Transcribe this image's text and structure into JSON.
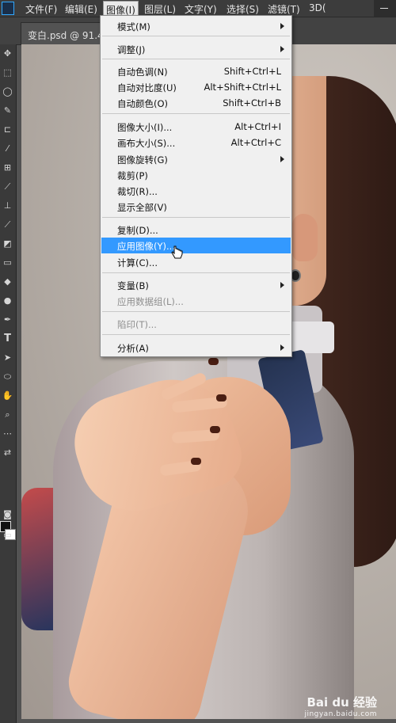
{
  "menubar": {
    "items": [
      "文件(F)",
      "编辑(E)",
      "图像(I)",
      "图层(L)",
      "文字(Y)",
      "选择(S)",
      "滤镜(T)",
      "3D("
    ]
  },
  "document_tab": {
    "title": "变白.psd @ 91.4%"
  },
  "image_menu": {
    "items": [
      {
        "label": "模式(M)",
        "submenu": true
      },
      {
        "label": "调整(J)",
        "submenu": true
      },
      {
        "label": "自动色调(N)",
        "shortcut": "Shift+Ctrl+L"
      },
      {
        "label": "自动对比度(U)",
        "shortcut": "Alt+Shift+Ctrl+L"
      },
      {
        "label": "自动颜色(O)",
        "shortcut": "Shift+Ctrl+B"
      },
      {
        "label": "图像大小(I)...",
        "shortcut": "Alt+Ctrl+I"
      },
      {
        "label": "画布大小(S)...",
        "shortcut": "Alt+Ctrl+C"
      },
      {
        "label": "图像旋转(G)",
        "submenu": true
      },
      {
        "label": "裁剪(P)"
      },
      {
        "label": "裁切(R)..."
      },
      {
        "label": "显示全部(V)"
      },
      {
        "label": "复制(D)..."
      },
      {
        "label": "应用图像(Y)...",
        "highlighted": true
      },
      {
        "label": "计算(C)..."
      },
      {
        "label": "变量(B)",
        "submenu": true
      },
      {
        "label": "应用数据组(L)...",
        "disabled": true
      },
      {
        "label": "陷印(T)...",
        "disabled": true
      },
      {
        "label": "分析(A)",
        "submenu": true
      }
    ]
  },
  "watermark": {
    "logo": "Bai du 经验",
    "url": "jingyan.baidu.com"
  },
  "colors": {
    "highlight": "#3399ff",
    "menu_bg": "#f0f0f0",
    "chrome": "#3c3c3c"
  }
}
